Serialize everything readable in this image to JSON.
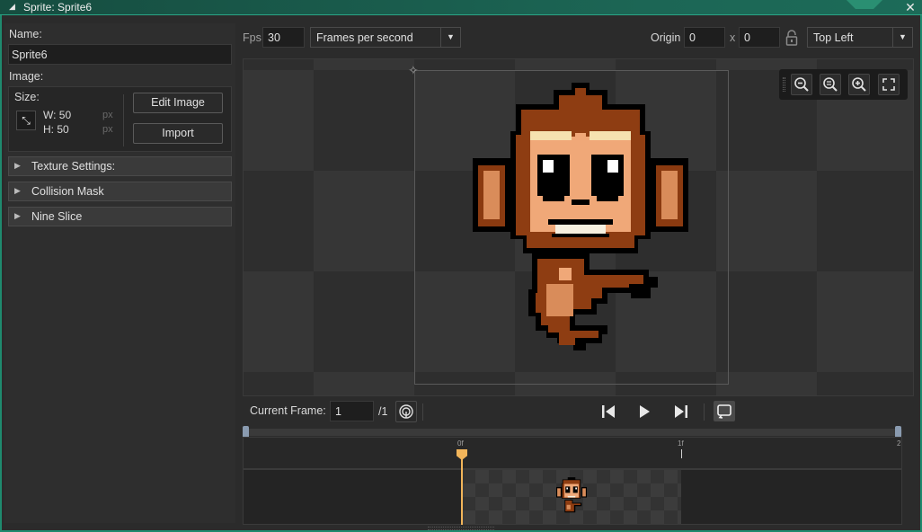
{
  "window": {
    "title": "Sprite: Sprite6",
    "close": "✕",
    "collapse_arrow": "◢"
  },
  "left": {
    "name_label": "Name:",
    "name_value": "Sprite6",
    "image_label": "Image:",
    "size_label": "Size:",
    "width_text": "W: 50",
    "height_text": "H: 50",
    "unit_w": "px",
    "unit_h": "px",
    "edit_image": "Edit Image",
    "import": "Import",
    "sections": [
      "Texture Settings:",
      "Collision Mask",
      "Nine Slice"
    ]
  },
  "toolbar": {
    "fps_label": "Fps",
    "fps_value": "30",
    "speed_mode": "Frames per second",
    "origin_label": "Origin",
    "origin_x": "0",
    "origin_sep": "x",
    "origin_y": "0",
    "origin_preset": "Top Left"
  },
  "canvas": {
    "zoom_buttons": [
      "zoom-out-icon",
      "zoom-reset-icon",
      "zoom-in-icon",
      "fit-icon"
    ]
  },
  "playback": {
    "current_frame_label": "Current Frame:",
    "current_frame_value": "1",
    "total_frames": "/1"
  },
  "timeline": {
    "tick_labels": [
      "0f",
      "1f",
      "2"
    ]
  },
  "colors": {
    "accent": "#1f8a6e",
    "playhead": "#f2b55a"
  }
}
